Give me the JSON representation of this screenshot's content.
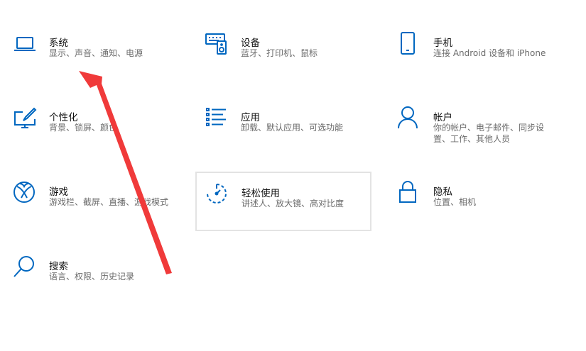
{
  "accent_color": "#0067c0",
  "annotation_color": "#f03a3a",
  "tiles": [
    {
      "icon": "laptop-icon",
      "title": "系统",
      "desc": "显示、声音、通知、电源"
    },
    {
      "icon": "keyboard-speaker-icon",
      "title": "设备",
      "desc": "蓝牙、打印机、鼠标"
    },
    {
      "icon": "phone-icon",
      "title": "手机",
      "desc": "连接 Android 设备和 iPhone"
    },
    {
      "icon": "personalization-brush-icon",
      "title": "个性化",
      "desc": "背景、锁屏、颜色"
    },
    {
      "icon": "apps-list-icon",
      "title": "应用",
      "desc": "卸载、默认应用、可选功能"
    },
    {
      "icon": "person-icon",
      "title": "帐户",
      "desc": "你的帐户、电子邮件、同步设置、工作、其他人员"
    },
    {
      "icon": "xbox-icon",
      "title": "游戏",
      "desc": "游戏栏、截屏、直播、游戏模式"
    },
    {
      "icon": "ease-of-access-icon",
      "title": "轻松使用",
      "desc": "讲述人、放大镜、高对比度"
    },
    {
      "icon": "lock-icon",
      "title": "隐私",
      "desc": "位置、相机"
    },
    {
      "icon": "search-icon",
      "title": "搜索",
      "desc": "语言、权限、历史记录"
    }
  ]
}
